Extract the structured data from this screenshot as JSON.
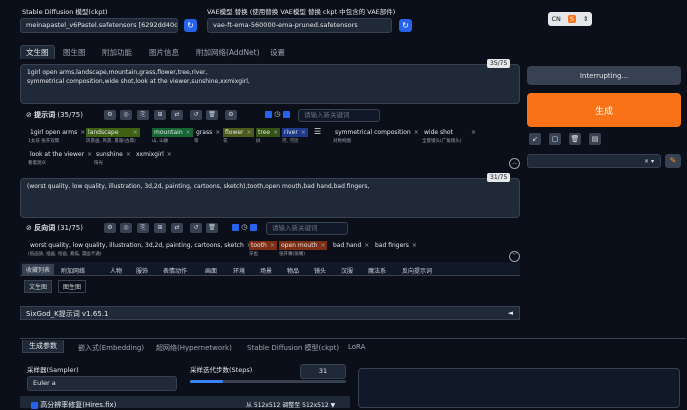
{
  "model": {
    "label": "Stable Diffusion 模型(ckpt)",
    "value": "meinapastel_v6Pastel.safetensors [6292dd40d6"
  },
  "vae": {
    "label": "VAE模型 替换 (使用替换 VAE模型 替换 ckpt 中包含的 VAE部件)",
    "value": "vae-ft-ema-560000-ema-pruned.safetensors"
  },
  "lang": {
    "value": "CN",
    "icon": "translate-icon"
  },
  "tabs": [
    "文生图",
    "图生图",
    "附加功能",
    "图片信息",
    "附加网络(AddNet)",
    "设置"
  ],
  "positive_prompt": {
    "text": "1girl open arms,landscape,mountain,grass,flower,tree,river,\nsymmetrical composition,wide shot,look at the viewer,sunshine,xxmixgirl,",
    "counter": "35/75",
    "label": "提示词",
    "count": "(35/75)",
    "placeholder": "请输入新关键词",
    "tags": [
      {
        "text": "1girl open arms",
        "sub": "1女孩 张开双臂"
      },
      {
        "text": "landscape",
        "sub": "风景画, 风景, 景观(古典)"
      },
      {
        "text": "mountain",
        "sub": "山, 山脉"
      },
      {
        "text": "grass",
        "sub": "草"
      },
      {
        "text": "flower",
        "sub": "花"
      },
      {
        "text": "tree",
        "sub": "树"
      },
      {
        "text": "river",
        "sub": "河, 河流"
      },
      {
        "text": "symmetrical composition",
        "sub": "对称构图"
      },
      {
        "text": "wide shot",
        "sub": "全景镜头(广角镜头)"
      },
      {
        "text": "look at the viewer",
        "sub": "看着观众"
      },
      {
        "text": "sunshine",
        "sub": "阳光"
      },
      {
        "text": "xxmixgirl",
        "sub": ""
      }
    ]
  },
  "negative_prompt": {
    "text": "(worst quality, low quality, illustration, 3d,2d, painting,  cartoons, sketch),tooth,open mouth,bad hand,bad fingers,",
    "counter": "31/75",
    "label": "反向词",
    "count": "(31/75)",
    "placeholder": "请输入新关键词",
    "tags": [
      {
        "text": "worst quality, low quality, illustration, 3d,2d, painting, cartoons, sketch",
        "sub": "(低画质, 插画, 绘画, 素描, 漫画卡通)"
      },
      {
        "text": "tooth",
        "sub": "牙齿"
      },
      {
        "text": "open mouth",
        "sub": "张开嘴(张嘴)"
      },
      {
        "text": "bad hand",
        "sub": ""
      },
      {
        "text": "bad fingers",
        "sub": ""
      }
    ]
  },
  "categories": [
    "收藏列表",
    "附加网络",
    "人物",
    "服饰",
    "表情动作",
    "画面",
    "环境",
    "场景",
    "物品",
    "镜头",
    "汉服",
    "魔法系",
    "反向提示词"
  ],
  "subtabs": [
    "文生图",
    "图生图"
  ],
  "extension": {
    "title": "SixGod_K提示词 v1.65.1",
    "toggle": "◄"
  },
  "bottom_tabs": [
    "生成参数",
    "嵌入式(Embedding)",
    "超网络(Hypernetwork)",
    "Stable Diffusion 模型(ckpt)",
    "LoRA"
  ],
  "sampler": {
    "label": "采样器(Sampler)",
    "value": "Euler a"
  },
  "steps": {
    "label": "采样迭代步数(Steps)",
    "value": "31",
    "fraction": 0.21
  },
  "hires": {
    "label": "高分辨率修复(Hires.fix)",
    "from_label": "从 512x512 调整至 512x512"
  },
  "interrupt_label": "Interrupting...",
  "generate_label": "生成",
  "colors": {
    "accent": "#f97316",
    "blue": "#2563eb",
    "bg": "#0b0f19",
    "panel": "#1f2937"
  }
}
